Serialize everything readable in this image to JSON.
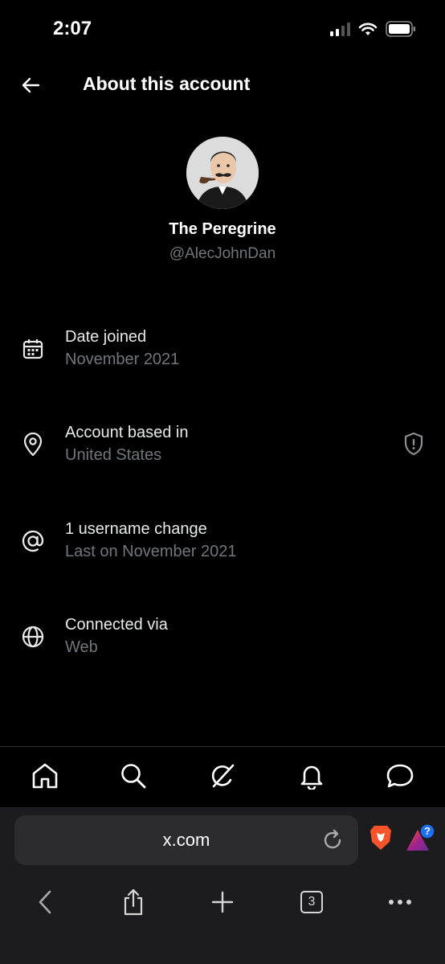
{
  "status": {
    "time": "2:07"
  },
  "header": {
    "title": "About this account"
  },
  "profile": {
    "display_name": "The Peregrine",
    "handle": "@AlecJohnDan"
  },
  "info_rows": [
    {
      "icon": "calendar-icon",
      "label": "Date joined",
      "value": "November 2021"
    },
    {
      "icon": "location-pin-icon",
      "label": "Account based in",
      "value": "United States"
    },
    {
      "icon": "at-sign-icon",
      "label": "1 username change",
      "value": "Last on November 2021"
    },
    {
      "icon": "globe-icon",
      "label": "Connected via",
      "value": "Web"
    }
  ],
  "tab_bar": [
    "home-icon",
    "search-icon",
    "grok-icon",
    "notifications-icon",
    "messages-icon"
  ],
  "browser": {
    "url": "x.com",
    "tab_count": "3",
    "extension_badge": "?"
  },
  "colors": {
    "background": "#000000",
    "secondary_text": "#71767b",
    "badge_blue": "#1d6ff2",
    "brave_orange": "#fb542b"
  }
}
